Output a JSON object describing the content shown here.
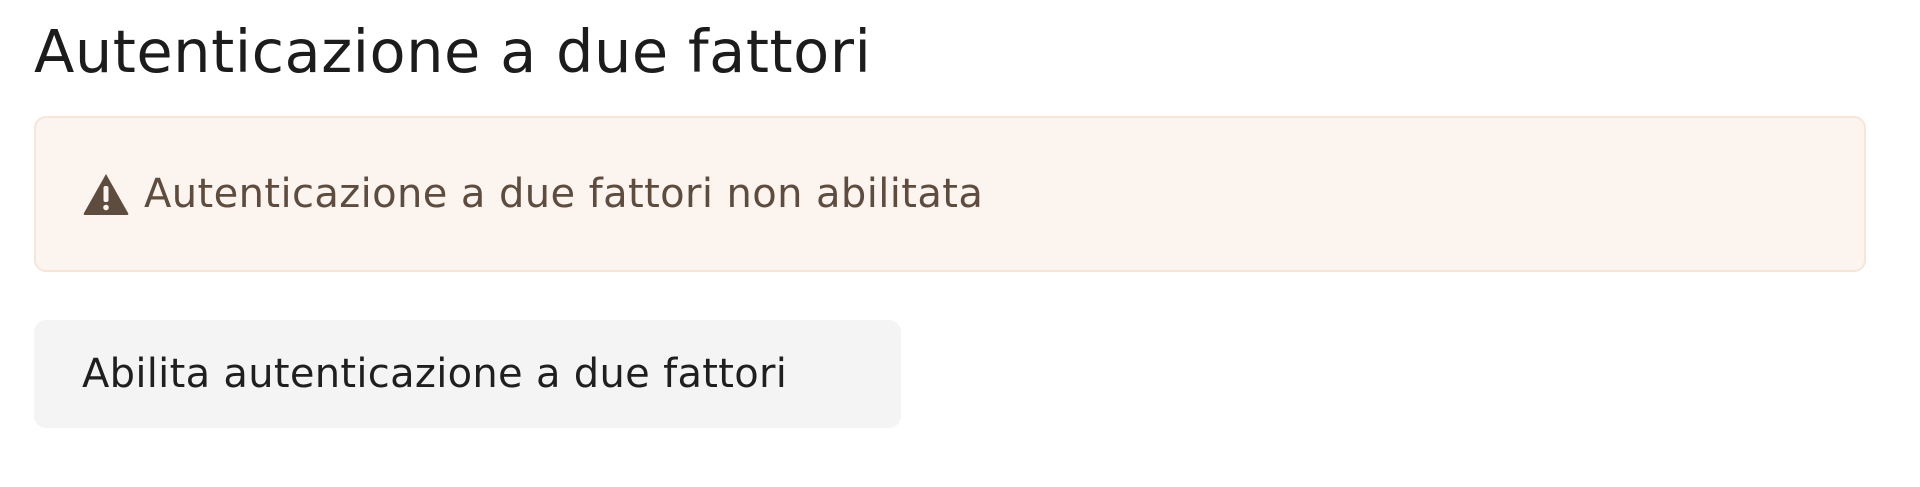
{
  "section": {
    "title": "Autenticazione a due fattori"
  },
  "alert": {
    "icon": "warning-triangle-icon",
    "message": "Autenticazione a due fattori non abilitata",
    "background_color": "#fcf4ef",
    "border_color": "#f6e5d9",
    "text_color": "#5e4d3e"
  },
  "actions": {
    "enable_label": "Abilita autenticazione a due fattori"
  }
}
